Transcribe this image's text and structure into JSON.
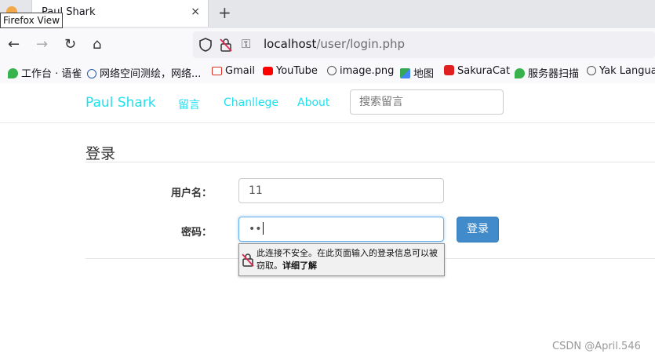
{
  "browser": {
    "tab": {
      "title": "Paul Shark",
      "close_glyph": "×"
    },
    "new_tab_glyph": "+",
    "tooltip": "Firefox View",
    "nav": {
      "back": "←",
      "forward": "→",
      "reload": "↻",
      "home": "⌂"
    },
    "url": {
      "host": "localhost",
      "path": "/user/login.php",
      "key_glyph": "⚿"
    },
    "bookmarks": [
      {
        "label": "工作台 · 语雀",
        "icon": "yuque-icon",
        "color": "#37b24d"
      },
      {
        "label": "网络空间测绘，网络...",
        "icon": "fofa-icon",
        "color": "#2b5aa8"
      },
      {
        "label": "Gmail",
        "icon": "gmail-icon",
        "color": "#d93025"
      },
      {
        "label": "YouTube",
        "icon": "youtube-icon",
        "color": "#ff0000"
      },
      {
        "label": "image.png",
        "icon": "globe-icon",
        "color": "#555555"
      },
      {
        "label": "地图",
        "icon": "maps-icon",
        "color": "#34a853"
      },
      {
        "label": "SakuraCat",
        "icon": "cat-icon",
        "color": "#e02020"
      },
      {
        "label": "服务器扫描",
        "icon": "yuque-icon",
        "color": "#37b24d"
      },
      {
        "label": "Yak Languag",
        "icon": "globe-icon",
        "color": "#555555"
      }
    ]
  },
  "site": {
    "brand": "Paul Shark",
    "nav": [
      "留言",
      "Chanllege",
      "About"
    ],
    "search_placeholder": "搜索留言",
    "accent": "#1fe0f0"
  },
  "login": {
    "title": "登录",
    "username_label": "用户名：",
    "username_value": "11",
    "password_label": "密码：",
    "password_value": "••",
    "submit": "登录",
    "submit_color": "#428bca"
  },
  "insecure_warning": {
    "text": "此连接不安全。在此页面输入的登录信息可以被窃取。",
    "link": "详细了解"
  },
  "watermark": "CSDN @April.546"
}
